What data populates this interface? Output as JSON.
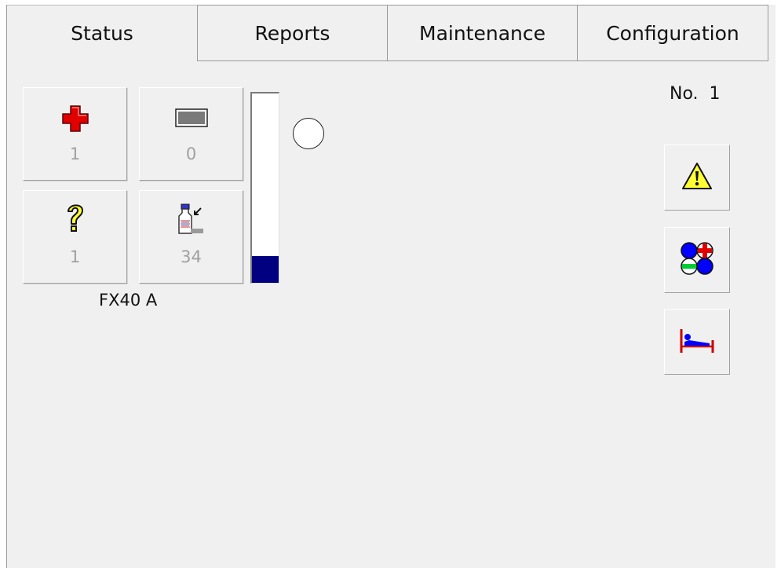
{
  "tabs": [
    {
      "label": "Status"
    },
    {
      "label": "Reports"
    },
    {
      "label": "Maintenance"
    },
    {
      "label": "Configuration"
    }
  ],
  "tiles": {
    "alarms": {
      "count": "1",
      "icon": "red-cross-icon"
    },
    "messages": {
      "count": "0",
      "icon": "gray-rectangle-icon"
    },
    "unknown": {
      "count": "1",
      "icon": "question-mark-icon"
    },
    "samples": {
      "count": "34",
      "icon": "sample-bottle-icon"
    }
  },
  "device": {
    "name": "FX40 A"
  },
  "gauge": {
    "level_fraction": 0.14,
    "fill_color": "#000080"
  },
  "unit": {
    "label": "No.  1"
  },
  "side_buttons": [
    {
      "icon": "warning-icon"
    },
    {
      "icon": "calibration-icon"
    },
    {
      "icon": "patient-bed-icon"
    }
  ],
  "colors": {
    "alarm_red": "#e00000",
    "warning_yellow": "#ffff33",
    "accent_blue": "#0000ff",
    "gauge_navy": "#000080"
  }
}
